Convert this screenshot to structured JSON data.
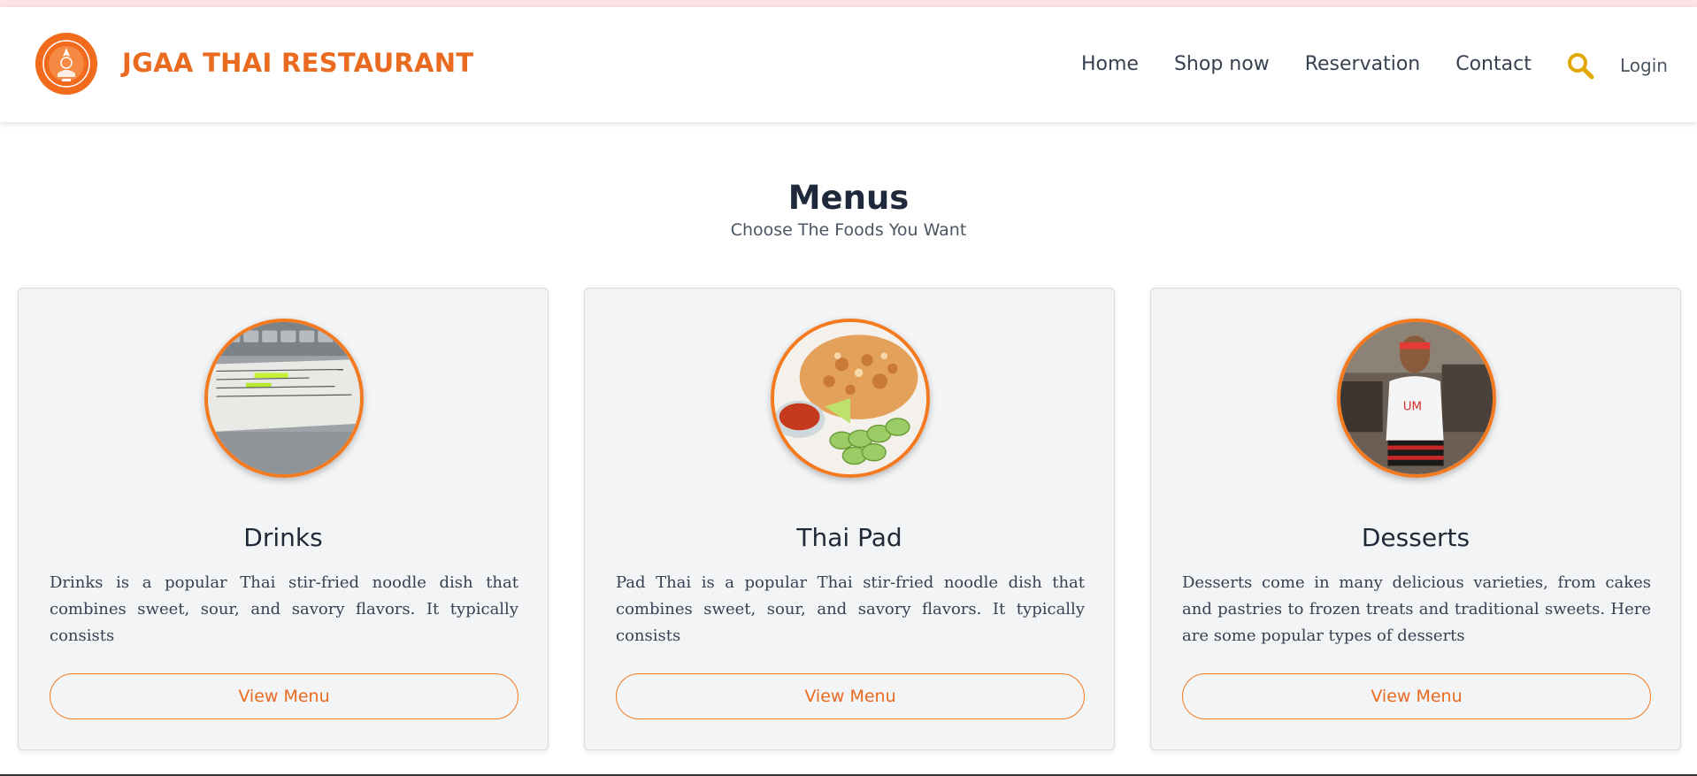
{
  "brand": {
    "name": "JGAA THAI RESTAURANT",
    "color": "#ea6a1f"
  },
  "nav": {
    "items": [
      {
        "label": "Home"
      },
      {
        "label": "Shop now"
      },
      {
        "label": "Reservation"
      },
      {
        "label": "Contact"
      }
    ],
    "search_icon": "search-icon",
    "login_label": "Login"
  },
  "section": {
    "title": "Menus",
    "subtitle": "Choose The Foods You Want"
  },
  "cards": [
    {
      "title": "Drinks",
      "description": "Drinks is a popular Thai stir-fried noodle dish that combines sweet, sour, and savory flavors. It typically consists",
      "button": "View Menu"
    },
    {
      "title": "Thai Pad",
      "description": "Pad Thai is a popular Thai stir-fried noodle dish that combines sweet, sour, and savory flavors. It typically consists",
      "button": "View Menu"
    },
    {
      "title": "Desserts",
      "description": "Desserts come in many delicious varieties, from cakes and pastries to frozen treats and traditional sweets. Here are some popular types of desserts",
      "button": "View Menu"
    }
  ],
  "colors": {
    "accent": "#f47a20",
    "search": "#e0a800",
    "card_bg": "#f3f4f6"
  }
}
